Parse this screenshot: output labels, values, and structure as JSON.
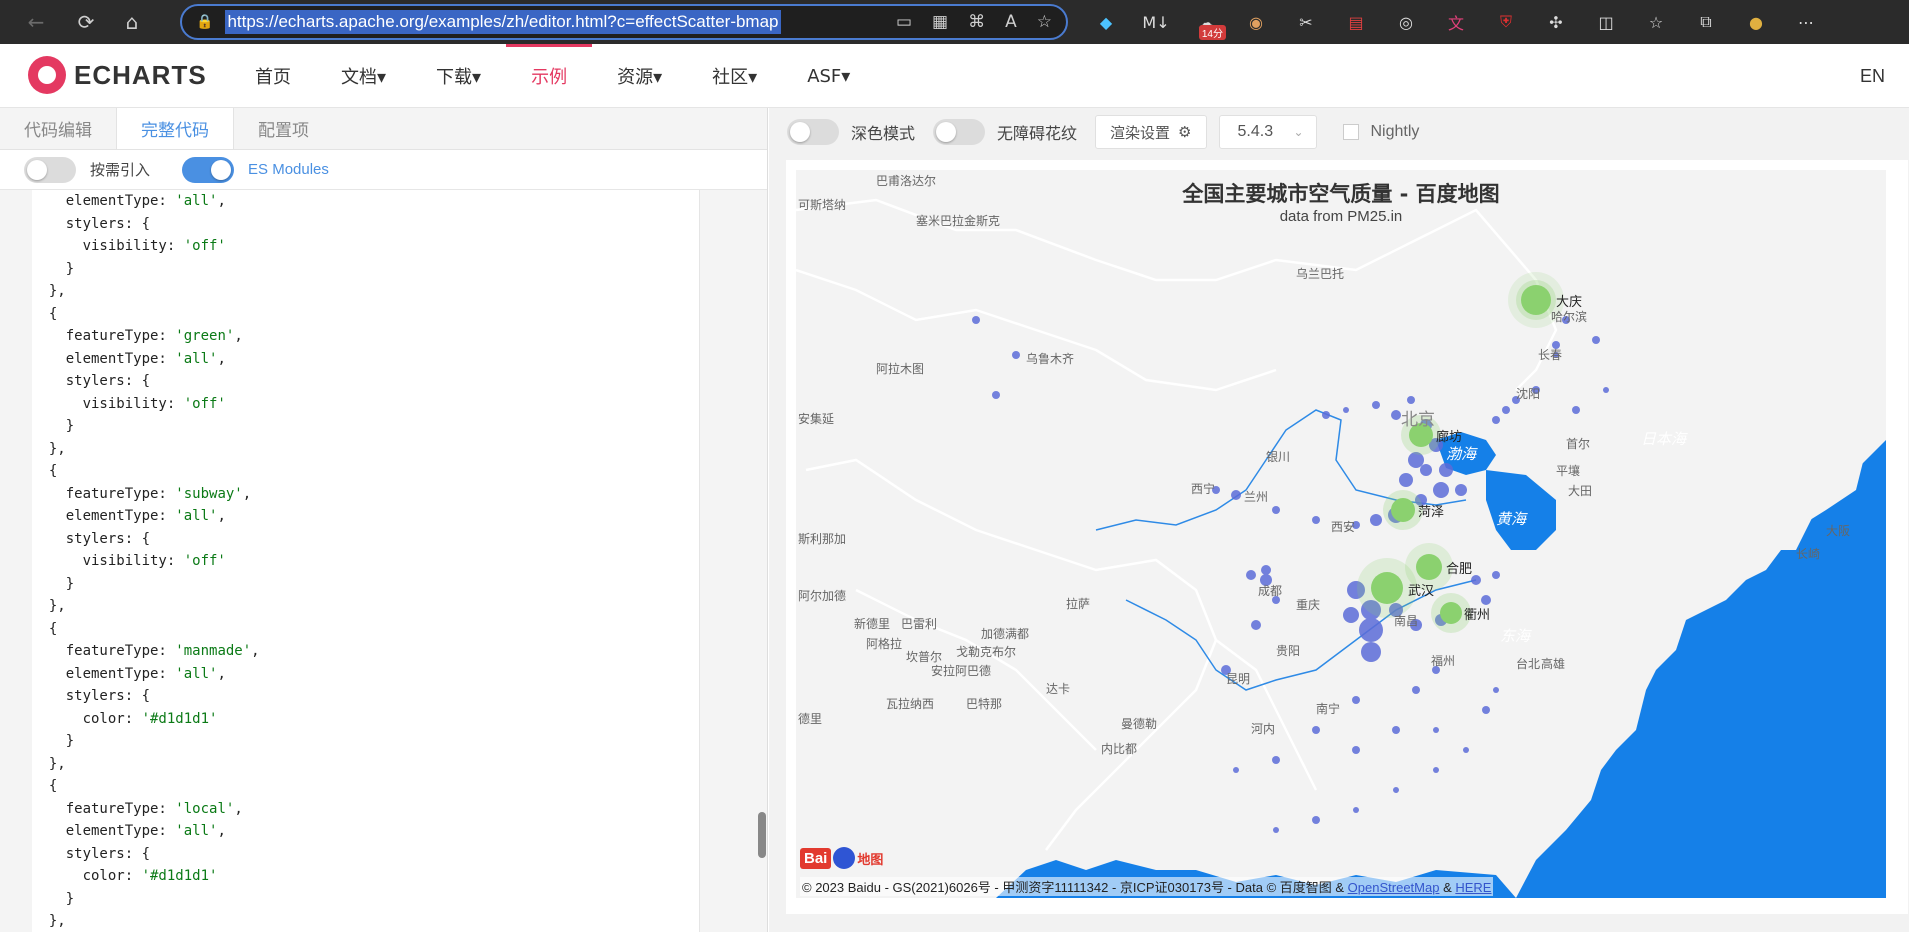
{
  "browser": {
    "url": "https://echarts.apache.org/examples/zh/editor.html?c=effectScatter-bmap",
    "badge": "14分"
  },
  "site": {
    "logo": "ECHARTS",
    "menu": [
      "首页",
      "文档▾",
      "下载▾",
      "示例",
      "资源▾",
      "社区▾",
      "ASF▾"
    ],
    "active_menu": "示例",
    "lang": "EN"
  },
  "editor": {
    "tabs": [
      "代码编辑",
      "完整代码",
      "配置项"
    ],
    "toggle_import_label": "按需引入",
    "toggle_esm_label": "ES Modules",
    "code_lines": [
      {
        "pre": "    elementType: ",
        "str": "'all'",
        "post": ","
      },
      {
        "pre": "    stylers: {",
        "str": "",
        "post": ""
      },
      {
        "pre": "      visibility: ",
        "str": "'off'",
        "post": ""
      },
      {
        "pre": "    }",
        "str": "",
        "post": ""
      },
      {
        "pre": "  },",
        "str": "",
        "post": ""
      },
      {
        "pre": "  {",
        "str": "",
        "post": ""
      },
      {
        "pre": "    featureType: ",
        "str": "'green'",
        "post": ","
      },
      {
        "pre": "    elementType: ",
        "str": "'all'",
        "post": ","
      },
      {
        "pre": "    stylers: {",
        "str": "",
        "post": ""
      },
      {
        "pre": "      visibility: ",
        "str": "'off'",
        "post": ""
      },
      {
        "pre": "    }",
        "str": "",
        "post": ""
      },
      {
        "pre": "  },",
        "str": "",
        "post": ""
      },
      {
        "pre": "  {",
        "str": "",
        "post": ""
      },
      {
        "pre": "    featureType: ",
        "str": "'subway'",
        "post": ","
      },
      {
        "pre": "    elementType: ",
        "str": "'all'",
        "post": ","
      },
      {
        "pre": "    stylers: {",
        "str": "",
        "post": ""
      },
      {
        "pre": "      visibility: ",
        "str": "'off'",
        "post": ""
      },
      {
        "pre": "    }",
        "str": "",
        "post": ""
      },
      {
        "pre": "  },",
        "str": "",
        "post": ""
      },
      {
        "pre": "  {",
        "str": "",
        "post": ""
      },
      {
        "pre": "    featureType: ",
        "str": "'manmade'",
        "post": ","
      },
      {
        "pre": "    elementType: ",
        "str": "'all'",
        "post": ","
      },
      {
        "pre": "    stylers: {",
        "str": "",
        "post": ""
      },
      {
        "pre": "      color: ",
        "str": "'#d1d1d1'",
        "post": ""
      },
      {
        "pre": "    }",
        "str": "",
        "post": ""
      },
      {
        "pre": "  },",
        "str": "",
        "post": ""
      },
      {
        "pre": "  {",
        "str": "",
        "post": ""
      },
      {
        "pre": "    featureType: ",
        "str": "'local'",
        "post": ","
      },
      {
        "pre": "    elementType: ",
        "str": "'all'",
        "post": ","
      },
      {
        "pre": "    stylers: {",
        "str": "",
        "post": ""
      },
      {
        "pre": "      color: ",
        "str": "'#d1d1d1'",
        "post": ""
      },
      {
        "pre": "    }",
        "str": "",
        "post": ""
      },
      {
        "pre": "  },",
        "str": "",
        "post": ""
      }
    ]
  },
  "toolbar": {
    "dark_mode_label": "深色模式",
    "a11y_label": "无障碍花纹",
    "render_settings": "渲染设置",
    "version": "5.4.3",
    "nightly": "Nightly"
  },
  "chart": {
    "title": "全国主要城市空气质量 - 百度地图",
    "subtitle": "data from PM25.in",
    "top_cities": [
      "大庆",
      "廊坊",
      "菏泽",
      "合肥",
      "武汉",
      "衢州"
    ],
    "map_labels": [
      "巴甫洛达尔",
      "塞米巴拉金斯克",
      "可斯塔纳",
      "乌兰巴托",
      "阿拉木图",
      "乌鲁木齐",
      "北京",
      "银川",
      "西宁",
      "兰州",
      "西安",
      "成都",
      "重庆",
      "拉萨",
      "贵阳",
      "昆明",
      "南宁",
      "福州",
      "沈阳",
      "首尔",
      "平壤",
      "大田",
      "哈尔滨",
      "长春",
      "南昌",
      "新德里",
      "加德满都",
      "达卡",
      "曼德勒",
      "河内",
      "内比都",
      "安集延",
      "巴雷利",
      "阿格拉",
      "坎普尔",
      "戈勒克布尔",
      "安拉阿巴德",
      "瓦拉纳西",
      "巴特那",
      "阿尔加德",
      "斯利那加",
      "德里",
      "大阪",
      "长崎",
      "台北",
      "高雄"
    ],
    "seas": [
      "日本海",
      "黄海",
      "东海",
      "渤海"
    ],
    "copyright": "© 2023 Baidu - GS(2021)6026号 - 甲测资字11111342 - 京ICP证030173号 - Data © 百度智图 &",
    "link_osm": "OpenStreetMap",
    "link_here": "HERE",
    "baidu_logo": "Bai",
    "baidu_logo_2": "地图"
  },
  "colors": {
    "accent": "#e43961",
    "blue": "#4a90e2",
    "sea": "#1580e8",
    "scatter": "#5c6cd8",
    "top": "#8bd16f"
  }
}
